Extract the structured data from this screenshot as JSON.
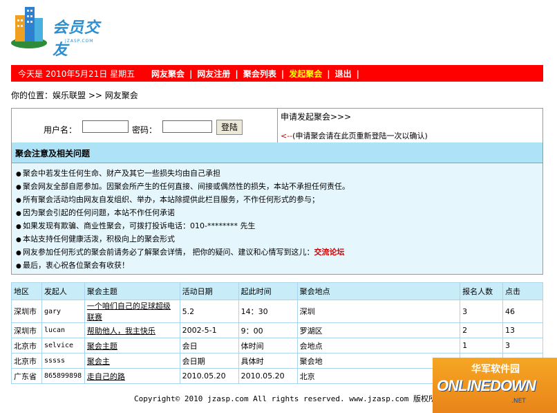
{
  "logo": {
    "text": "会员交友",
    "sub": "JZASP.COM"
  },
  "nav": {
    "date": "今天是  2010年5月21日 星期五",
    "items": [
      {
        "label": "网友聚会",
        "highlight": false
      },
      {
        "label": "网友注册",
        "highlight": false
      },
      {
        "label": "聚会列表",
        "highlight": false
      },
      {
        "label": "发起聚会",
        "highlight": true
      },
      {
        "label": "退出",
        "highlight": false
      }
    ],
    "sep": "|"
  },
  "breadcrumb": "你的位置：娱乐联盟 >> 网友聚会",
  "login": {
    "username_label": "用户名：",
    "password_label": "密码：",
    "button": "登陆",
    "apply_title": "申请发起聚会>>>",
    "apply_arrow": "<--",
    "apply_note": "(申请聚会请在此页重新登陆一次以确认)"
  },
  "notice": {
    "title": "聚会注意及相关问题",
    "items": [
      "聚会中若发生任何生命、财产及其它一些损失均由自己承担",
      "聚会网友全部自愿参加。因聚会所产生的任何直接、间接或偶然性的损失，本站不承担任何责任。",
      "所有聚会活动均由网友自发组织、举办，本站除提供此栏目服务，不作任何形式的参与；",
      "因为聚会引起的任何问题，本站不作任何承诺",
      "如果发现有欺骗、商业性聚会，可拨打投诉电话：010-******** 先生",
      "本站支持任何健康活泼，积极向上的聚会形式",
      "网友参加任何形式的聚会前请务必了解聚会详情， 把你的疑问、建议和心情写到这儿：",
      "最后，衷心祝各位聚会有收获！"
    ],
    "forum_link": "交流论坛"
  },
  "table": {
    "headers": [
      "地区",
      "发起人",
      "聚会主题",
      "活动日期",
      "起此时间",
      "聚会地点",
      "报名人数",
      "点击"
    ],
    "rows": [
      [
        "深圳市",
        "gary",
        "一个咱们自己的足球超级联赛",
        "5.2",
        "14：30",
        "深圳",
        "3",
        "46"
      ],
      [
        "深圳市",
        "lucan",
        "帮助他人，我主快乐",
        "2002-5-1",
        "9：00",
        "罗湖区",
        "2",
        "13"
      ],
      [
        "北京市",
        "selvice",
        "聚会主题",
        "会日",
        "体时间",
        "会地点",
        "1",
        "3"
      ],
      [
        "北京市",
        "sssss",
        "聚会主",
        "会日期",
        "具体时",
        "聚会地",
        "",
        ""
      ],
      [
        "广东省",
        "865899898",
        "走自己的路",
        "2010.05.20",
        "2010.05.20",
        "北京",
        "",
        ""
      ]
    ]
  },
  "footer": "Copyright© 2010 jzasp.com All rights reserved. www.jzasp.com 版权所有",
  "watermark": {
    "cn": "华军软件园",
    "en": "ONLINEDOWN",
    "dot": ".NET"
  },
  "colors": {
    "nav_bg": "#ff0000",
    "highlight": "#ffff00",
    "notice_head": "#aee3f7",
    "table_head": "#c9ecf9"
  }
}
